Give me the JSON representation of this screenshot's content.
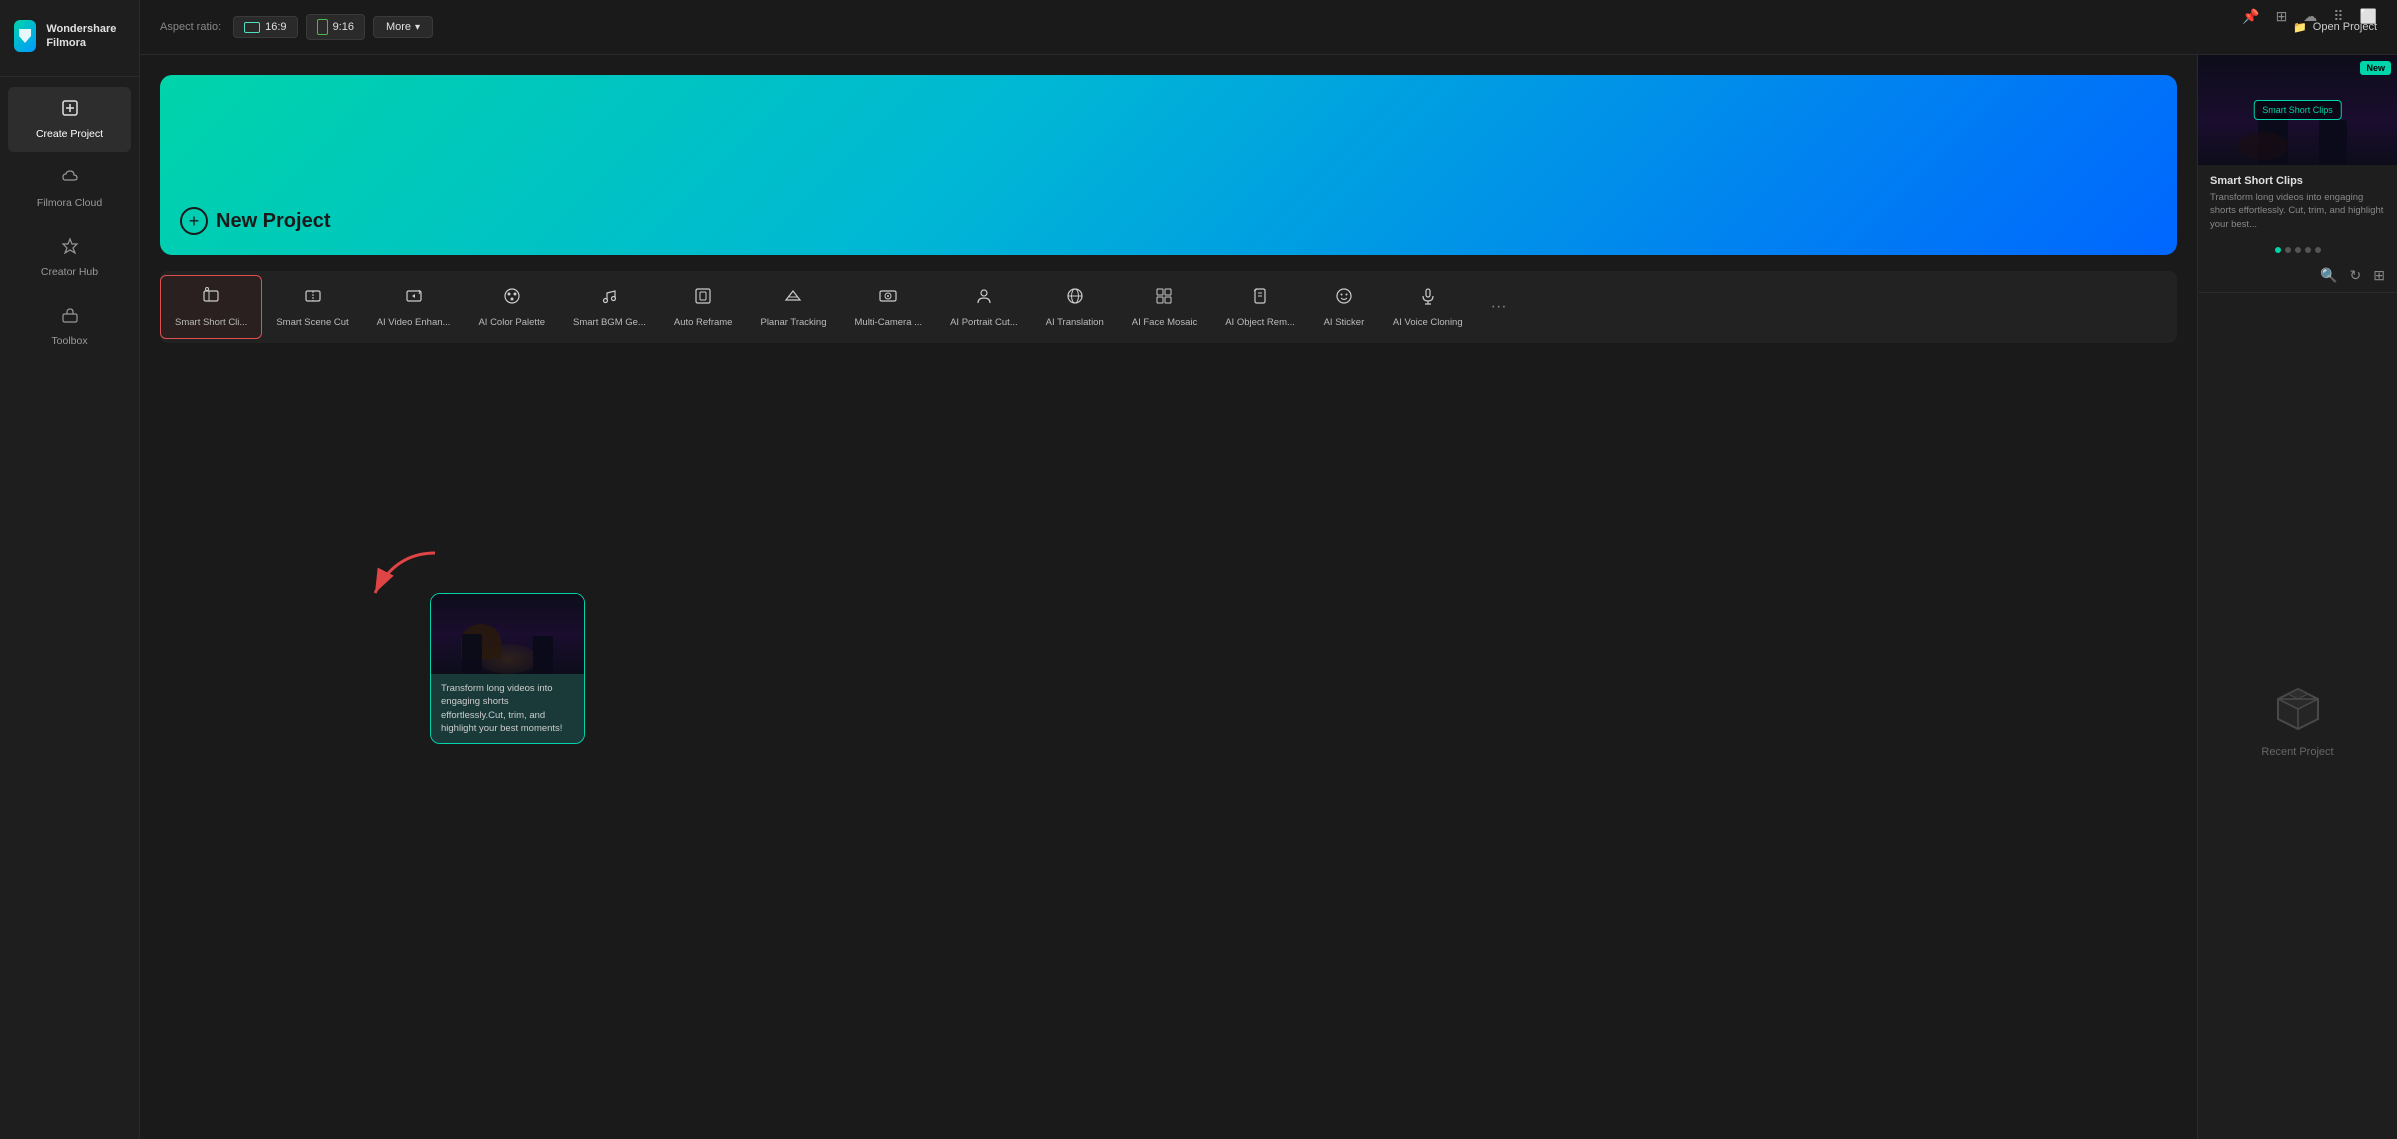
{
  "app": {
    "name": "Wondershare Filmora",
    "logo_initials": "W"
  },
  "tray": {
    "icons": [
      "pin",
      "grid",
      "cloud",
      "grid4",
      "maximize"
    ]
  },
  "sidebar": {
    "items": [
      {
        "id": "create-project",
        "label": "Create Project",
        "icon": "⊞",
        "active": true
      },
      {
        "id": "filmora-cloud",
        "label": "Filmora Cloud",
        "icon": "☁"
      },
      {
        "id": "creator-hub",
        "label": "Creator Hub",
        "icon": "⬡"
      },
      {
        "id": "toolbox",
        "label": "Toolbox",
        "icon": "🧰"
      }
    ]
  },
  "topbar": {
    "aspect_ratio_label": "Aspect ratio:",
    "ratio_16_9": "16:9",
    "ratio_9_16": "9:16",
    "more_label": "More",
    "open_project_label": "Open Project"
  },
  "new_project": {
    "label": "New Project"
  },
  "ai_tools": [
    {
      "id": "smart-short-clips",
      "label": "Smart Short Cli...",
      "icon": "✂",
      "selected": true
    },
    {
      "id": "smart-scene-cut",
      "label": "Smart Scene Cut",
      "icon": "🎬"
    },
    {
      "id": "ai-video-enhance",
      "label": "AI Video Enhan...",
      "icon": "✨"
    },
    {
      "id": "ai-color-palette",
      "label": "AI Color Palette",
      "icon": "🎨"
    },
    {
      "id": "smart-bgm-gen",
      "label": "Smart BGM Ge...",
      "icon": "🎵"
    },
    {
      "id": "auto-reframe",
      "label": "Auto Reframe",
      "icon": "⬜"
    },
    {
      "id": "planar-tracking",
      "label": "Planar Tracking",
      "icon": "📐"
    },
    {
      "id": "multi-camera",
      "label": "Multi-Camera ...",
      "icon": "📷"
    },
    {
      "id": "ai-portrait-cut",
      "label": "AI Portrait Cut...",
      "icon": "👤"
    },
    {
      "id": "ai-translation",
      "label": "AI Translation",
      "icon": "🌐"
    },
    {
      "id": "ai-face-mosaic",
      "label": "AI Face Mosaic",
      "icon": "⬛"
    },
    {
      "id": "ai-object-rem",
      "label": "AI Object Rem...",
      "icon": "🗑"
    },
    {
      "id": "ai-sticker",
      "label": "AI Sticker",
      "icon": "😊"
    },
    {
      "id": "ai-voice-cloning",
      "label": "AI Voice Cloning",
      "icon": "🎤"
    }
  ],
  "tooltip": {
    "title": "Smart Short Clips",
    "description": "Transform long videos into engaging shorts effortlessly.Cut, trim, and highlight your best moments!"
  },
  "right_panel": {
    "badge_new": "New",
    "feature_label": "Smart Short Clips",
    "title": "Smart Short Clips",
    "description": "Transform long videos into engaging shorts effortlessly. Cut, trim, and highlight your best...",
    "dots": [
      true,
      false,
      false,
      false,
      false
    ]
  },
  "recent": {
    "label": "Recent Project",
    "empty_message": "Recent Project"
  }
}
